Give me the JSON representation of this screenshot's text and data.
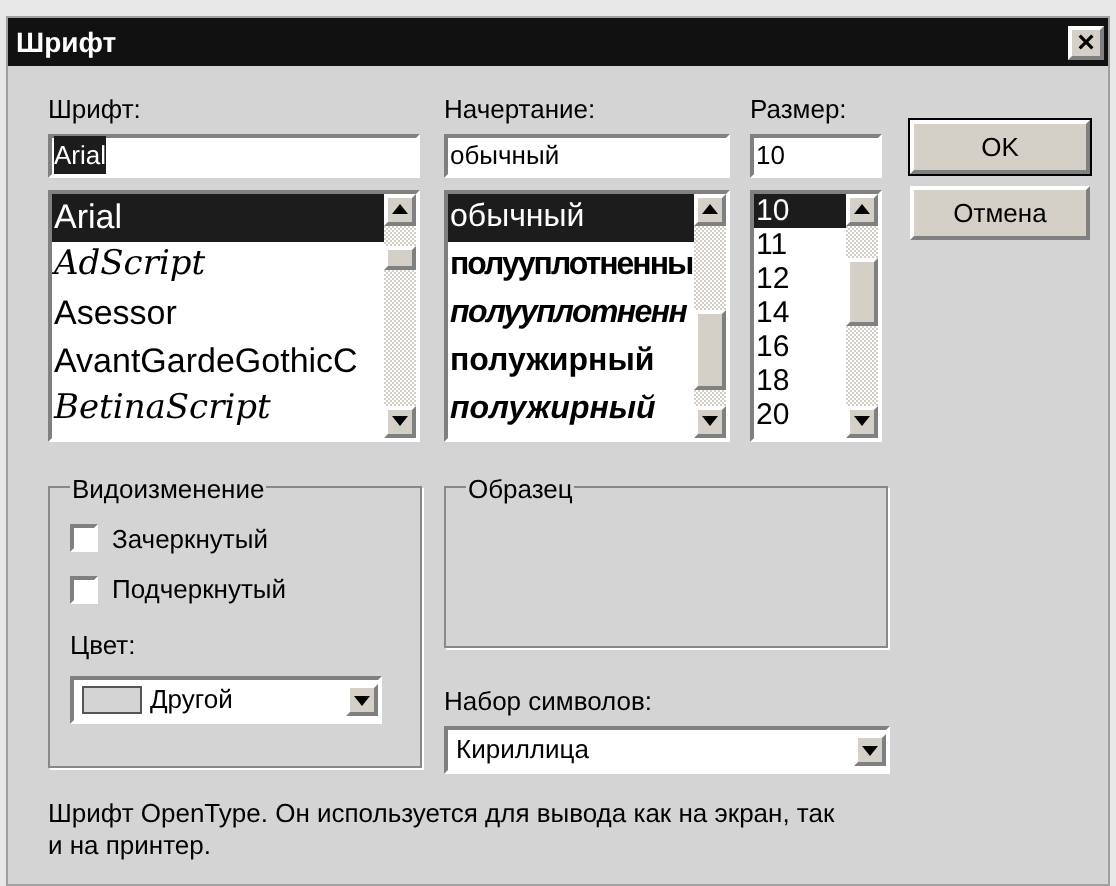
{
  "window": {
    "title": "Шрифт",
    "close": "×"
  },
  "font": {
    "label": "Шрифт:",
    "value": "Arial",
    "items": [
      {
        "text": "Arial",
        "kind": "plain",
        "selected": true
      },
      {
        "text": "AdScript",
        "kind": "script",
        "selected": false
      },
      {
        "text": "Asessor",
        "kind": "plain",
        "selected": false
      },
      {
        "text": "AvantGardeGothicC",
        "kind": "plain",
        "selected": false
      },
      {
        "text": "BetinaScript",
        "kind": "script",
        "selected": false
      }
    ]
  },
  "style": {
    "label": "Начертание:",
    "value": "обычный",
    "items": [
      {
        "text": "обычный",
        "kind": "regular",
        "selected": true
      },
      {
        "text": "полууплотненны",
        "kind": "condensed",
        "selected": false
      },
      {
        "text": "полууплотненн",
        "kind": "condensed-italic",
        "selected": false
      },
      {
        "text": "полужирный",
        "kind": "bold",
        "selected": false
      },
      {
        "text": "полужирный",
        "kind": "bold-italic",
        "selected": false
      }
    ]
  },
  "size": {
    "label": "Размер:",
    "value": "10",
    "items": [
      {
        "text": "10",
        "selected": true
      },
      {
        "text": "11",
        "selected": false
      },
      {
        "text": "12",
        "selected": false
      },
      {
        "text": "14",
        "selected": false
      },
      {
        "text": "16",
        "selected": false
      },
      {
        "text": "18",
        "selected": false
      },
      {
        "text": "20",
        "selected": false
      }
    ]
  },
  "buttons": [
    {
      "label": "OK",
      "default": true
    },
    {
      "label": "Отмена",
      "default": false
    }
  ],
  "effects": {
    "title": "Видоизменение",
    "checkboxes": [
      {
        "label": "Зачеркнутый",
        "checked": false
      },
      {
        "label": "Подчеркнутый",
        "checked": false
      }
    ],
    "color_label": "Цвет:",
    "color_value": "Другой"
  },
  "sample": {
    "title": "Образец"
  },
  "charset": {
    "label": "Набор символов:",
    "value": "Кириллица"
  },
  "description": "Шрифт OpenType. Он используется для вывода как на экран, так и на принтер."
}
